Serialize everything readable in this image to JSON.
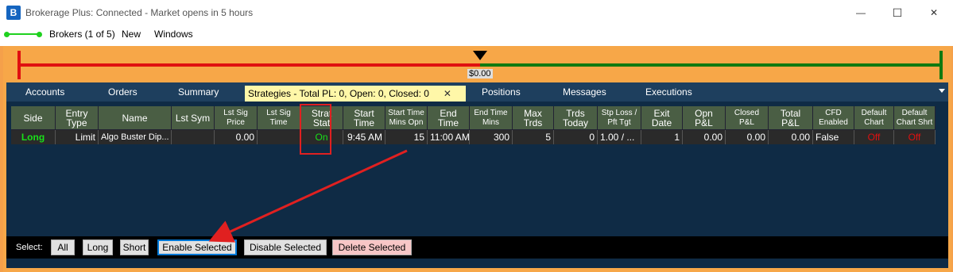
{
  "window": {
    "icon_letter": "B",
    "title": "Brokerage Plus: Connected - Market opens in 5 hours",
    "minimize_glyph": "—",
    "maximize_glyph": "☐",
    "close_glyph": "✕"
  },
  "menu": {
    "brokers": "Brokers (1 of 5)",
    "new": "New",
    "windows": "Windows"
  },
  "pl_meter": {
    "value": "$0.00"
  },
  "tabs": [
    {
      "label": "Accounts"
    },
    {
      "label": "Orders"
    },
    {
      "label": "Summary"
    },
    {
      "label": "Strategies - Total PL: 0, Open: 0, Closed: 0",
      "active": true
    },
    {
      "label": "Positions"
    },
    {
      "label": "Messages"
    },
    {
      "label": "Executions"
    }
  ],
  "tab_close_glyph": "✕",
  "columns": [
    {
      "h1": "Side",
      "h2": ""
    },
    {
      "h1": "Entry",
      "h2": "Type"
    },
    {
      "h1": "Name",
      "h2": ""
    },
    {
      "h1": "Lst Sym",
      "h2": ""
    },
    {
      "h1": "Lst Sig",
      "h2": "Price"
    },
    {
      "h1": "Lst Sig",
      "h2": "Time"
    },
    {
      "h1": "Strat",
      "h2": "Stat"
    },
    {
      "h1": "Start",
      "h2": "Time"
    },
    {
      "h1": "Start Time",
      "h2": "Mins Opn"
    },
    {
      "h1": "End",
      "h2": "Time"
    },
    {
      "h1": "End Time",
      "h2": "Mins"
    },
    {
      "h1": "Max",
      "h2": "Trds"
    },
    {
      "h1": "Trds",
      "h2": "Today"
    },
    {
      "h1": "Stp Loss /",
      "h2": "Pft Tgt"
    },
    {
      "h1": "Exit",
      "h2": "Date"
    },
    {
      "h1": "Opn",
      "h2": "P&L"
    },
    {
      "h1": "Closed",
      "h2": "P&L"
    },
    {
      "h1": "Total",
      "h2": "P&L"
    },
    {
      "h1": "CFD",
      "h2": "Enabled"
    },
    {
      "h1": "Default",
      "h2": "Chart"
    },
    {
      "h1": "Default",
      "h2": "Chart Shrt"
    }
  ],
  "row": {
    "side": "Long",
    "entry_type": "Limit",
    "name": "Algo Buster Dip...",
    "lst_sym": "",
    "lst_sig_price": "0.00",
    "lst_sig_time": "",
    "strat_stat": "On",
    "start_time": "9:45 AM",
    "start_mins": "15",
    "end_time": "11:00 AM",
    "end_mins": "300",
    "max_trds": "5",
    "trds_today": "0",
    "stp_loss": "1.00 / ...",
    "exit_date": "1",
    "opn_pl": "0.00",
    "closed_pl": "0.00",
    "total_pl": "0.00",
    "cfd_enabled": "False",
    "default_chart": "Off",
    "default_chart_shrt": "Off"
  },
  "bottom": {
    "select_label": "Select:",
    "all": "All",
    "long": "Long",
    "short": "Short",
    "enable": "Enable Selected",
    "disable": "Disable Selected",
    "delete": "Delete Selected"
  },
  "colors": {
    "accent_orange": "#f7a748",
    "panel_bg": "#0f2b45",
    "on_green": "#19e019",
    "off_red": "#e01010",
    "annotation_red": "#e02020"
  }
}
